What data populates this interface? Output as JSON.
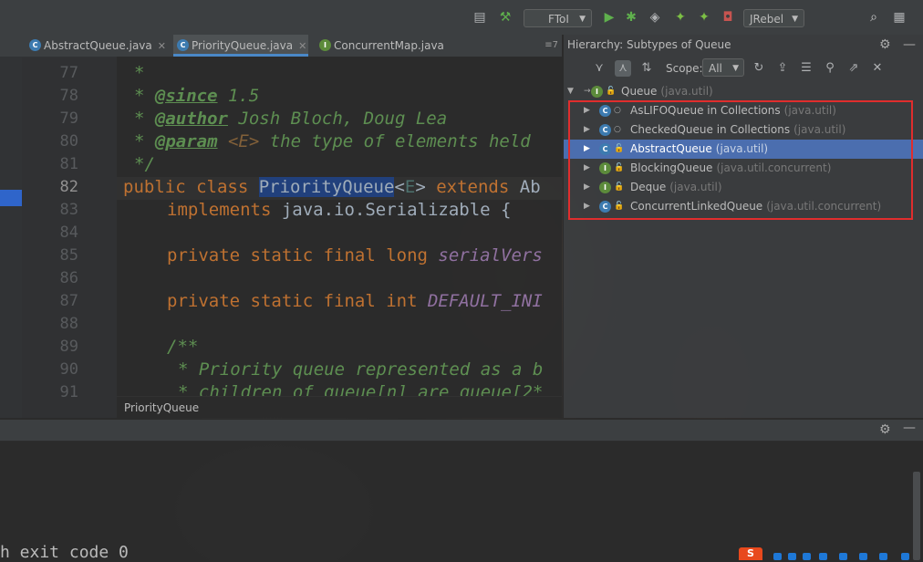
{
  "toolbar": {
    "run_config": "FToI",
    "jrebel_label": "JRebel"
  },
  "tabs": [
    {
      "label": "AbstractQueue.java",
      "kind": "C",
      "active": false
    },
    {
      "label": "PriorityQueue.java",
      "kind": "C",
      "active": true
    },
    {
      "label": "ConcurrentMap.java",
      "kind": "I",
      "active": false
    }
  ],
  "tab_overflow": "≡7",
  "editor": {
    "line_numbers": [
      "77",
      "78",
      "79",
      "80",
      "81",
      "82",
      "83",
      "84",
      "85",
      "86",
      "87",
      "88",
      "89",
      "90",
      "91"
    ],
    "current_line": "82",
    "breadcrumb": "PriorityQueue",
    "code": {
      "l77": "*",
      "l78_tag": "@since",
      "l78_text": " 1.5",
      "l79_tag": "@author",
      "l79_text": " Josh Bloch, Doug Lea",
      "l80_tag": "@param",
      "l80_param": " <E>",
      "l80_text": " the type of elements held",
      "l81": "*/",
      "l82_kw": "public class ",
      "l82_class": "PriorityQueue",
      "l82_lt": "<",
      "l82_tparam": "E",
      "l82_rest": "> ",
      "l82_kw2": "extends",
      "l82_tail": " Ab",
      "l83_kw": "implements",
      "l83_text": " java.io.Serializable {",
      "l85_kw": "private static final long ",
      "l85_field": "serialVers",
      "l87_kw": "private static final int ",
      "l87_field": "DEFAULT_INI",
      "l89": "/**",
      "l90": "* Priority queue represented as a b",
      "l91": "* children of queue[n] are queue[2*"
    }
  },
  "hierarchy": {
    "title": "Hierarchy:  Subtypes of Queue",
    "scope_label": "Scope:",
    "scope_value": "All",
    "root": {
      "name": "Queue",
      "pkg": "(java.util)"
    },
    "children": [
      {
        "name": "AsLIFOQueue in Collections",
        "pkg": "(java.util)",
        "kind": "C",
        "selected": false
      },
      {
        "name": "CheckedQueue in Collections",
        "pkg": "(java.util)",
        "kind": "C",
        "selected": false
      },
      {
        "name": "AbstractQueue",
        "pkg": "(java.util)",
        "kind": "C",
        "selected": true
      },
      {
        "name": "BlockingQueue",
        "pkg": "(java.util.concurrent)",
        "kind": "I",
        "selected": false
      },
      {
        "name": "Deque",
        "pkg": "(java.util)",
        "kind": "I",
        "selected": false
      },
      {
        "name": "ConcurrentLinkedQueue",
        "pkg": "(java.util.concurrent)",
        "kind": "C",
        "selected": false
      }
    ]
  },
  "console": {
    "last_line": "h exit code 0"
  },
  "tray": {
    "ime_label": "S"
  },
  "colors": {
    "accent_selection": "#4b6eaf",
    "annotation_box": "#e02d2d",
    "keyword": "#cc7832",
    "doc_comment": "#629755"
  }
}
